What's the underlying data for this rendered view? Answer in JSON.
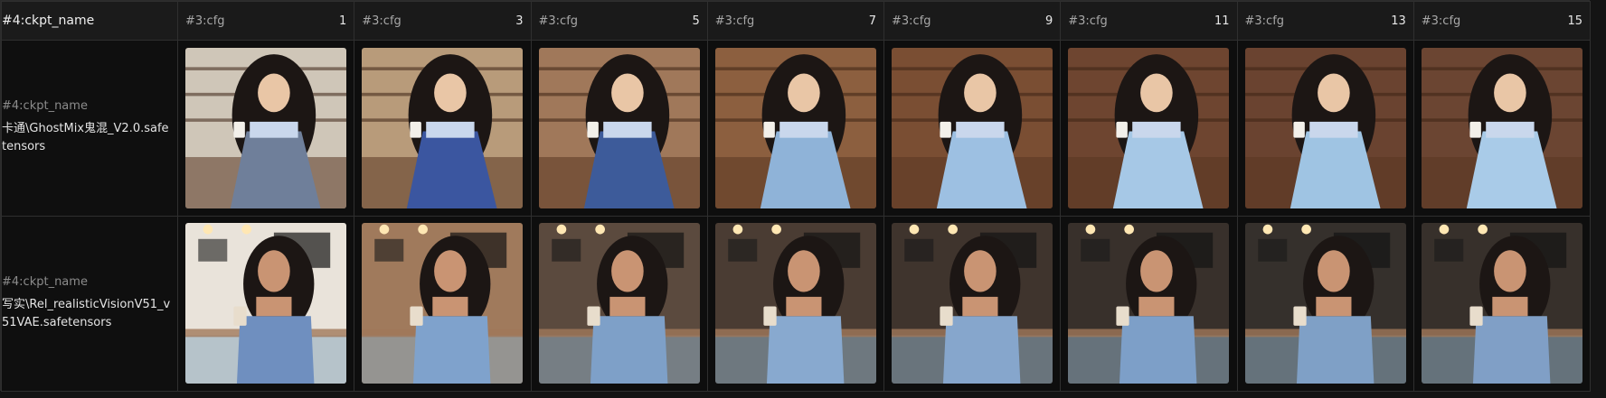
{
  "corner": {
    "label": "#4:ckpt_name"
  },
  "columns": [
    {
      "axis": "#3:cfg",
      "value": "1"
    },
    {
      "axis": "#3:cfg",
      "value": "3"
    },
    {
      "axis": "#3:cfg",
      "value": "5"
    },
    {
      "axis": "#3:cfg",
      "value": "7"
    },
    {
      "axis": "#3:cfg",
      "value": "9"
    },
    {
      "axis": "#3:cfg",
      "value": "11"
    },
    {
      "axis": "#3:cfg",
      "value": "13"
    },
    {
      "axis": "#3:cfg",
      "value": "15"
    }
  ],
  "rows": [
    {
      "axis": "#4:ckpt_name",
      "value": "卡通\\GhostMix鬼混_V2.0.safetensors",
      "style": "anime"
    },
    {
      "axis": "#4:ckpt_name",
      "value": "写实\\Rel_realisticVisionV51_v51VAE.safetensors",
      "style": "realistic"
    }
  ],
  "palette": {
    "anime_bg": [
      "#cfc6b8",
      "#b89b7a",
      "#a0785a",
      "#8c5f3f",
      "#7a4e33",
      "#6e4530",
      "#6a4330",
      "#6b4532"
    ],
    "anime_dress": [
      "#6f7f9a",
      "#3b56a0",
      "#3d5b9a",
      "#8fb3d8",
      "#9dc0e2",
      "#a6c8e6",
      "#9fc4e3",
      "#a9cbe8"
    ],
    "real_bg": [
      "#e9e3da",
      "#a07a5c",
      "#5b4a3e",
      "#4a3c33",
      "#3f342d",
      "#38302b",
      "#35302c",
      "#37302b"
    ],
    "real_top": [
      "#6f8fbf",
      "#7fa2cc",
      "#7ea0c8",
      "#88a9cf",
      "#86a6cc",
      "#7d9fc8",
      "#7fa0c6",
      "#809fc6"
    ],
    "hair": "#1c1614",
    "skin": "#e9c6a6",
    "skin_real": "#c99473"
  }
}
